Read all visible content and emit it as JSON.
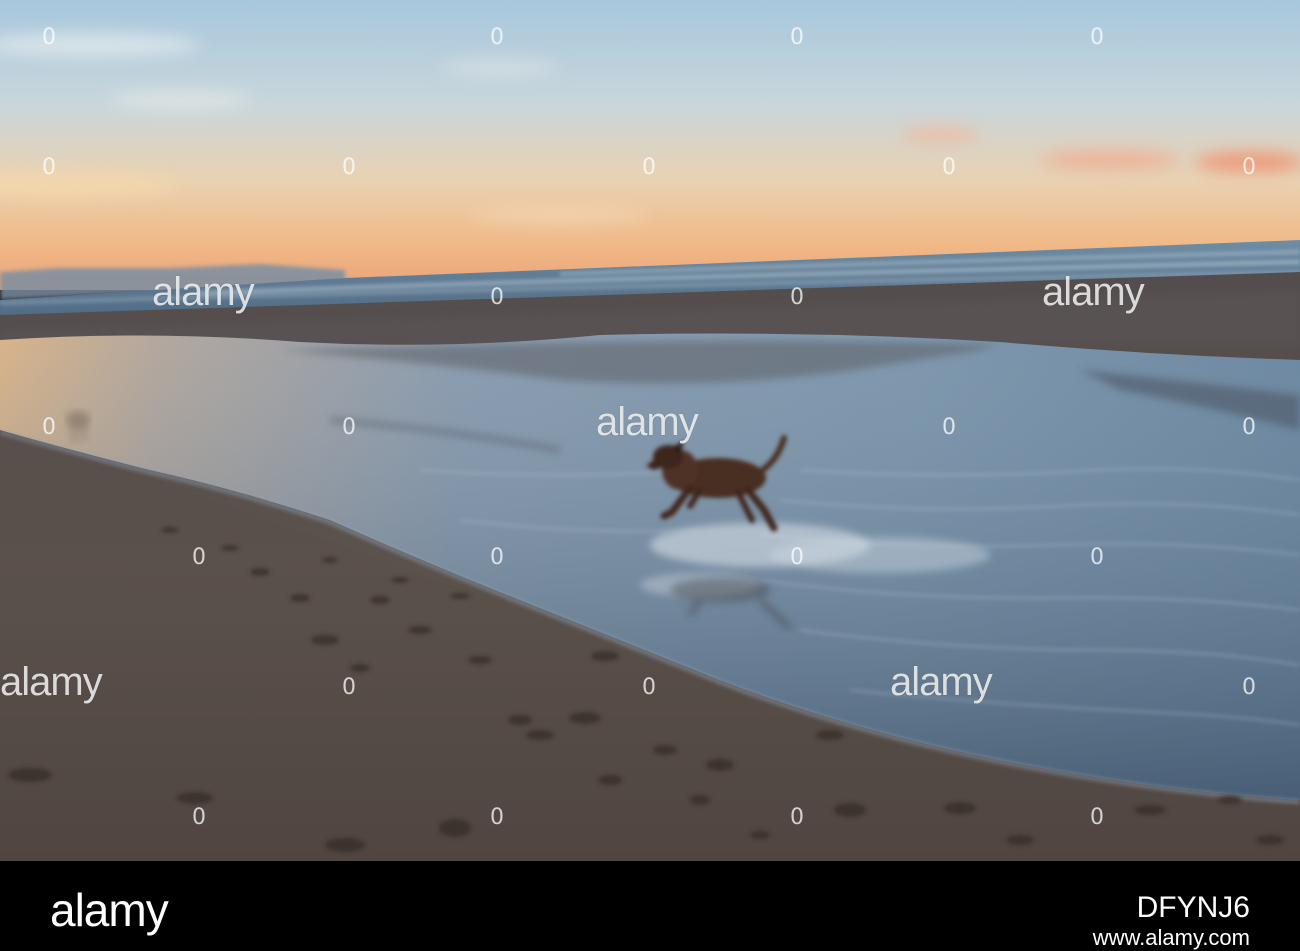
{
  "watermark": {
    "text": "alamy",
    "dot": "0"
  },
  "footer": {
    "logo": "alamy",
    "image_id": "DFYNJ6",
    "url": "www.alamy.com"
  },
  "colors": {
    "sky_top": "#a9c8de",
    "sky_horizon": "#f0b07a",
    "sea": "#5d7e97",
    "sand": "#5a5350",
    "water": "#7d96ac",
    "dog": "#4a2f22"
  }
}
